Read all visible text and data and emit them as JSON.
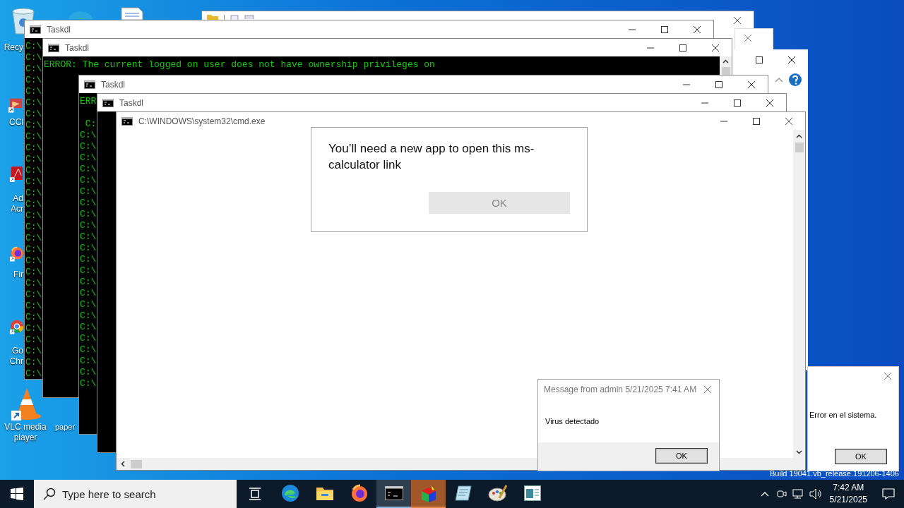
{
  "desktop_icons": [
    {
      "lines": [
        "Recy"
      ]
    },
    {
      "lines": [
        "CCl"
      ]
    },
    {
      "lines": [
        "Ad",
        "Acr"
      ]
    },
    {
      "lines": [
        "Fir"
      ]
    },
    {
      "lines": [
        "Go",
        "Chr"
      ]
    },
    {
      "lines": [
        "VLC media",
        "player"
      ]
    },
    {
      "lines": [
        "paper"
      ]
    }
  ],
  "console_windows": [
    {
      "title": "Taskdl",
      "lines": [
        "C:\\",
        "C:\\",
        "C:\\",
        "C:\\",
        "C:\\",
        "C:\\",
        "C:\\",
        "C:\\",
        "C:\\",
        "C:\\",
        "C:\\",
        "C:\\",
        "C:\\",
        "C:\\",
        "C:\\",
        "C:\\",
        "C:\\",
        "C:\\",
        "C:\\",
        "C:\\",
        "C:\\",
        "C:\\",
        "C:\\",
        "C:\\",
        "C:\\",
        "C:\\",
        "C:\\",
        "C:\\",
        "C:\\",
        "C:\\"
      ]
    },
    {
      "title": "Taskdl",
      "lines": [
        "ERROR: The current logged on user does not have ownership privileges on"
      ]
    },
    {
      "title": "Taskdl",
      "lines": [
        "ERR",
        " C:",
        "C:\\",
        "C:\\",
        "C:\\",
        "C:\\",
        "C:\\",
        "C:\\",
        "C:\\",
        "C:\\",
        "C:\\",
        "C:\\",
        "C:\\",
        "C:\\",
        "C:\\",
        "C:\\",
        "C:\\",
        "C:\\",
        "C:\\",
        "C:\\",
        "C:\\",
        "C:\\",
        "C:\\",
        "C:\\",
        "C:\\"
      ]
    },
    {
      "title": "Taskdl"
    }
  ],
  "cmd_window": {
    "title": "C:\\WINDOWS\\system32\\cmd.exe"
  },
  "app_dialog": {
    "message": "You’ll need a new app to open this ms-calculator link",
    "button": "OK"
  },
  "message_dialog": {
    "title": "Message from admin 5/21/2025 7:41 AM",
    "message": "Virus detectado",
    "button": "OK"
  },
  "error_dialog": {
    "message": "Error en el sistema.",
    "button": "OK"
  },
  "build_text": "Build 19041.vb_release.191206-1406",
  "taskbar": {
    "search": {
      "placeholder": "Type here to search"
    },
    "apps": [
      {
        "kind": "edge",
        "active": false
      },
      {
        "kind": "folder",
        "active": false
      },
      {
        "kind": "firefox",
        "active": false
      },
      {
        "kind": "console",
        "active": true
      },
      {
        "kind": "cube",
        "active": true
      },
      {
        "kind": "notepad",
        "active": false
      },
      {
        "kind": "paint",
        "active": false
      },
      {
        "kind": "window",
        "active": false
      }
    ],
    "time": "7:42 AM",
    "date": "5/21/2025"
  }
}
